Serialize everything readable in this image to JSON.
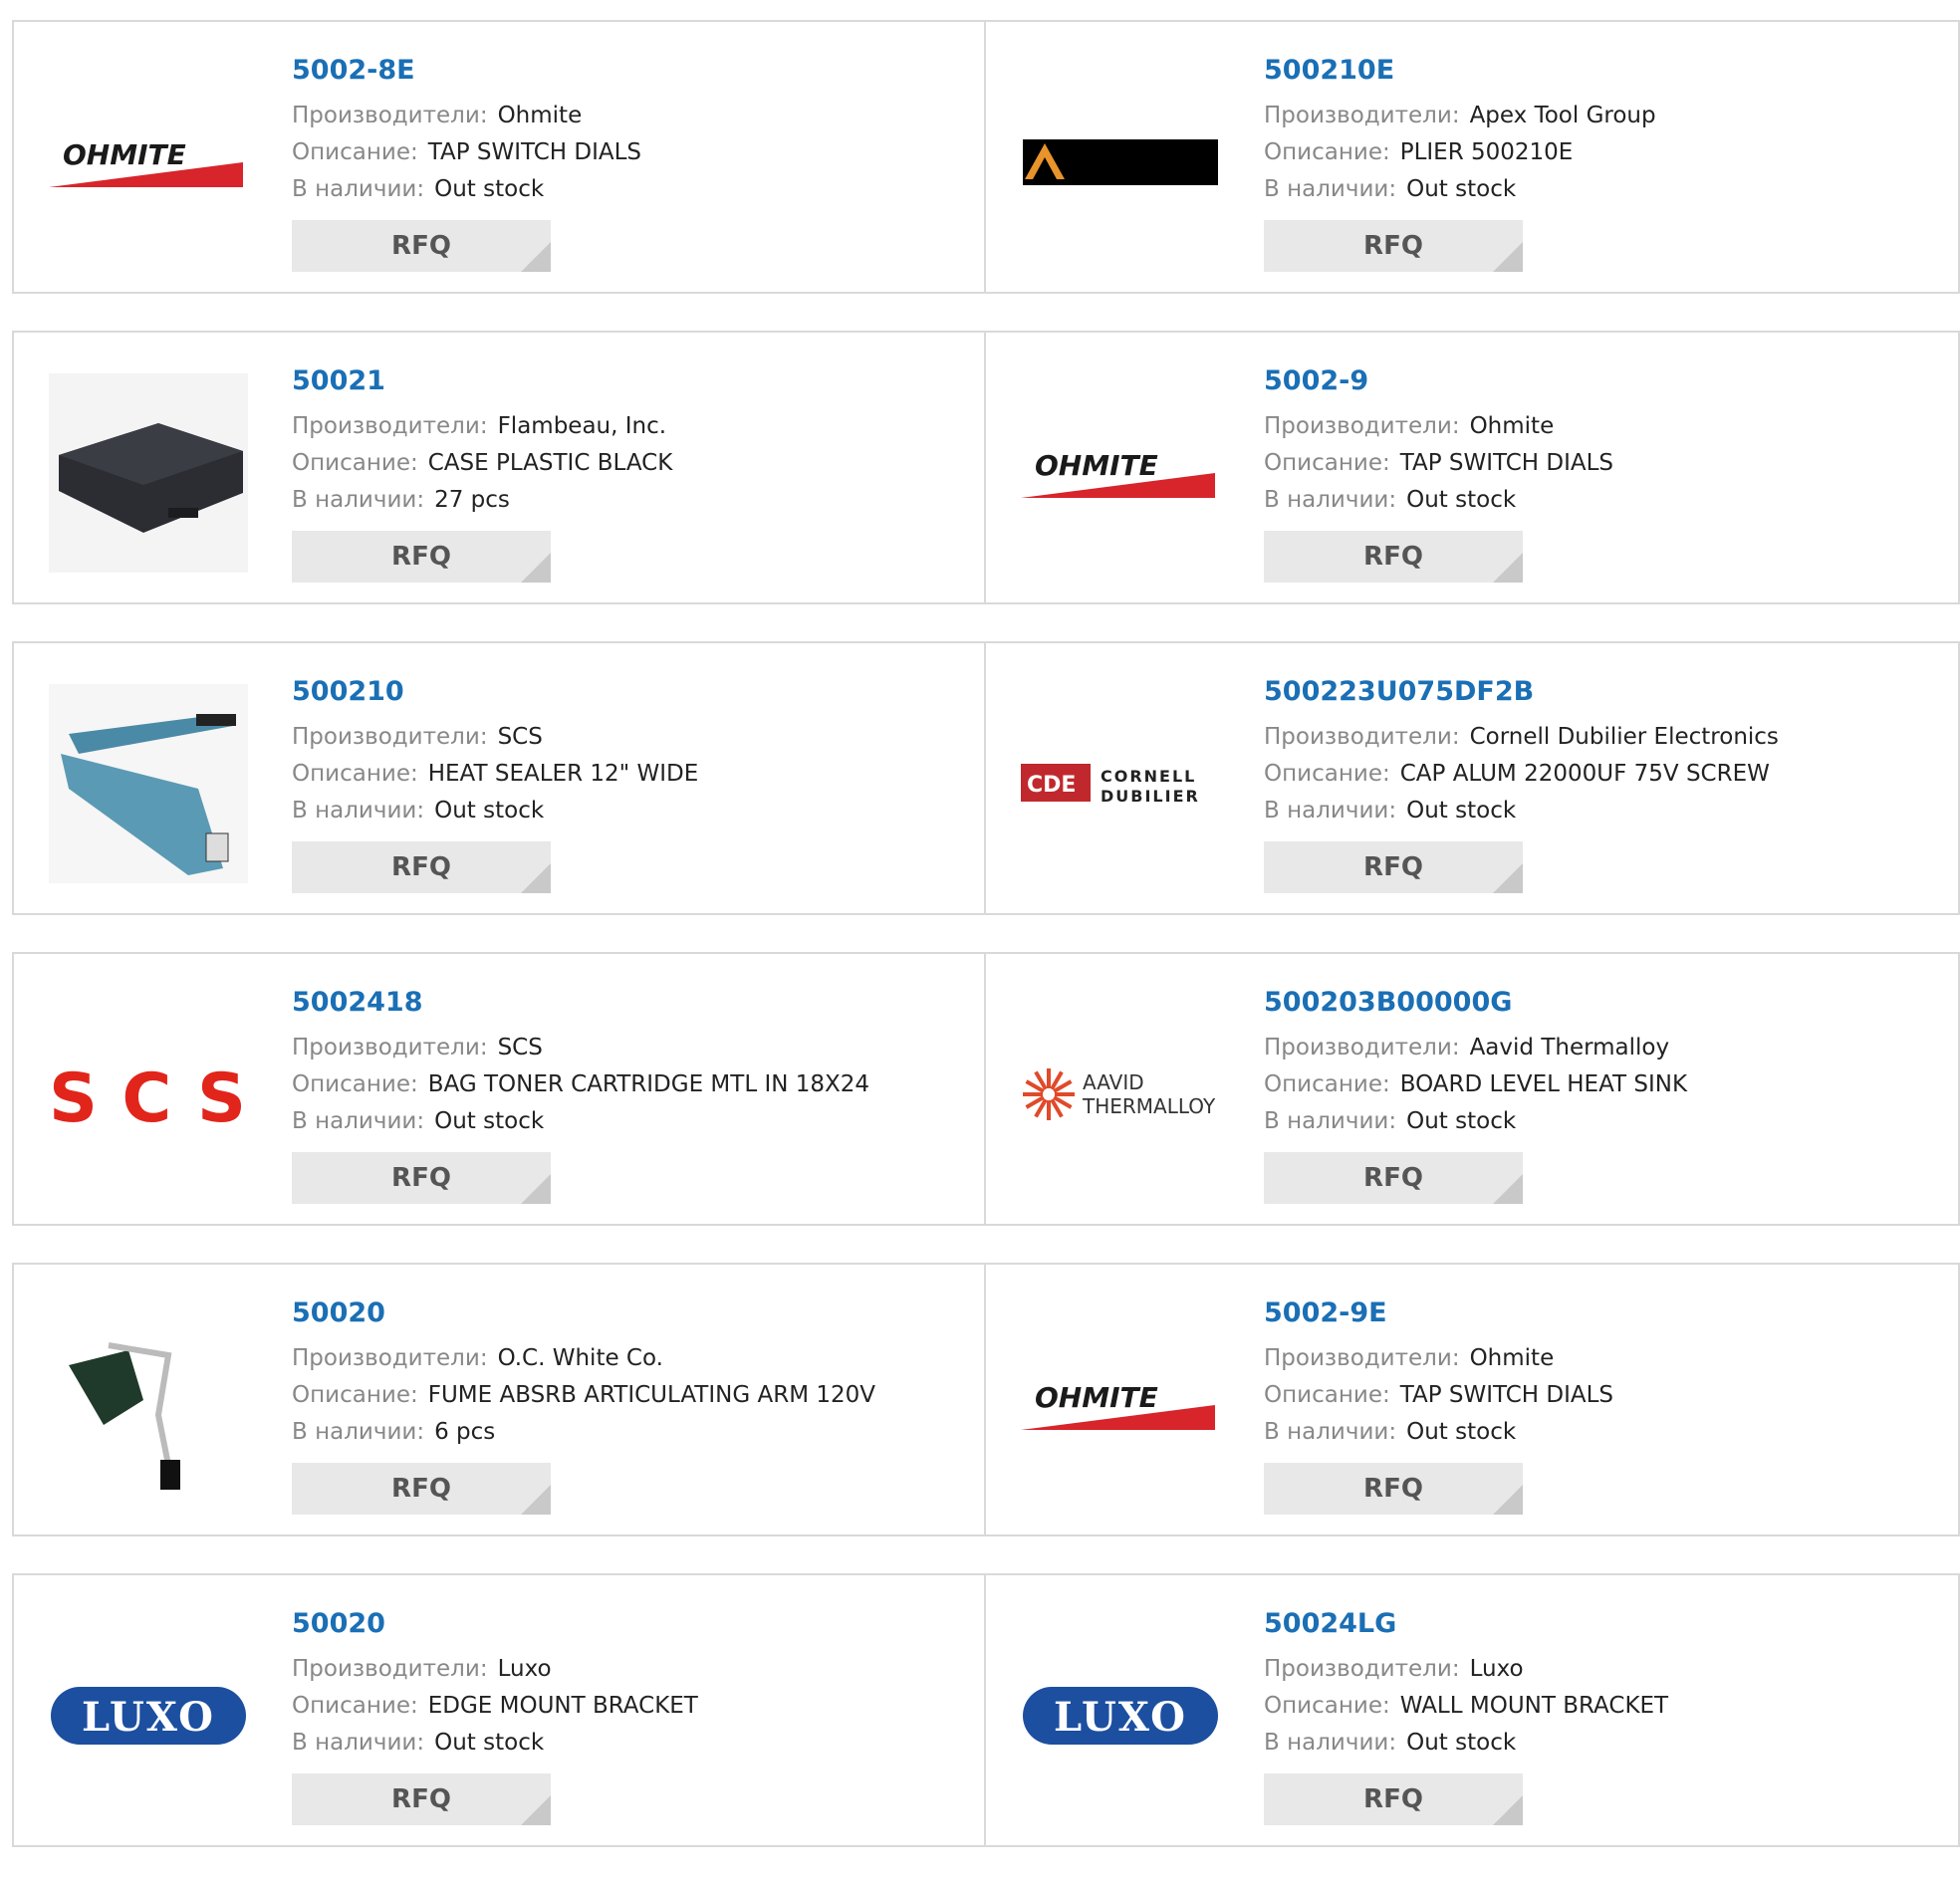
{
  "labels": {
    "manufacturer": "Производители:",
    "description": "Описание:",
    "stock": "В наличии:",
    "rfq": "RFQ"
  },
  "colors": {
    "link": "#1a6fb5",
    "label": "#888888",
    "value": "#222222",
    "button_bg": "#e8e8e8"
  },
  "products": [
    {
      "part": "5002-8E",
      "manufacturer": "Ohmite",
      "description": "TAP SWITCH DIALS",
      "stock": "Out stock",
      "image": "ohmite-logo"
    },
    {
      "part": "500210E",
      "manufacturer": "Apex Tool Group",
      "description": "PLIER 500210E",
      "stock": "Out stock",
      "image": "apex-logo"
    },
    {
      "part": "50021",
      "manufacturer": "Flambeau, Inc.",
      "description": "CASE PLASTIC BLACK",
      "stock": "27 pcs",
      "image": "black-case-photo"
    },
    {
      "part": "5002-9",
      "manufacturer": "Ohmite",
      "description": "TAP SWITCH DIALS",
      "stock": "Out stock",
      "image": "ohmite-logo"
    },
    {
      "part": "500210",
      "manufacturer": "SCS",
      "description": "HEAT SEALER 12\" WIDE",
      "stock": "Out stock",
      "image": "heat-sealer-photo"
    },
    {
      "part": "500223U075DF2B",
      "manufacturer": "Cornell Dubilier Electronics",
      "description": "CAP ALUM 22000UF 75V SCREW",
      "stock": "Out stock",
      "image": "cde-logo"
    },
    {
      "part": "5002418",
      "manufacturer": "SCS",
      "description": "BAG TONER CARTRIDGE MTL IN 18X24",
      "stock": "Out stock",
      "image": "scs-logo"
    },
    {
      "part": "500203B00000G",
      "manufacturer": "Aavid Thermalloy",
      "description": "BOARD LEVEL HEAT SINK",
      "stock": "Out stock",
      "image": "aavid-logo"
    },
    {
      "part": "50020",
      "manufacturer": "O.C. White Co.",
      "description": "FUME ABSRB ARTICULATING ARM 120V",
      "stock": "6 pcs",
      "image": "fume-arm-photo"
    },
    {
      "part": "5002-9E",
      "manufacturer": "Ohmite",
      "description": "TAP SWITCH DIALS",
      "stock": "Out stock",
      "image": "ohmite-logo"
    },
    {
      "part": "50020",
      "manufacturer": "Luxo",
      "description": "EDGE MOUNT BRACKET",
      "stock": "Out stock",
      "image": "luxo-logo"
    },
    {
      "part": "50024LG",
      "manufacturer": "Luxo",
      "description": "WALL MOUNT BRACKET",
      "stock": "Out stock",
      "image": "luxo-logo"
    }
  ],
  "logo_text": {
    "ohmite": "OHMITE",
    "scs": "SCS",
    "luxo": "LUXO",
    "cde_mark": "CDE",
    "cde_name_1": "CORNELL",
    "cde_name_2": "DUBILIER",
    "aavid_1": "AAVID",
    "aavid_2": "THERMALLOY"
  }
}
